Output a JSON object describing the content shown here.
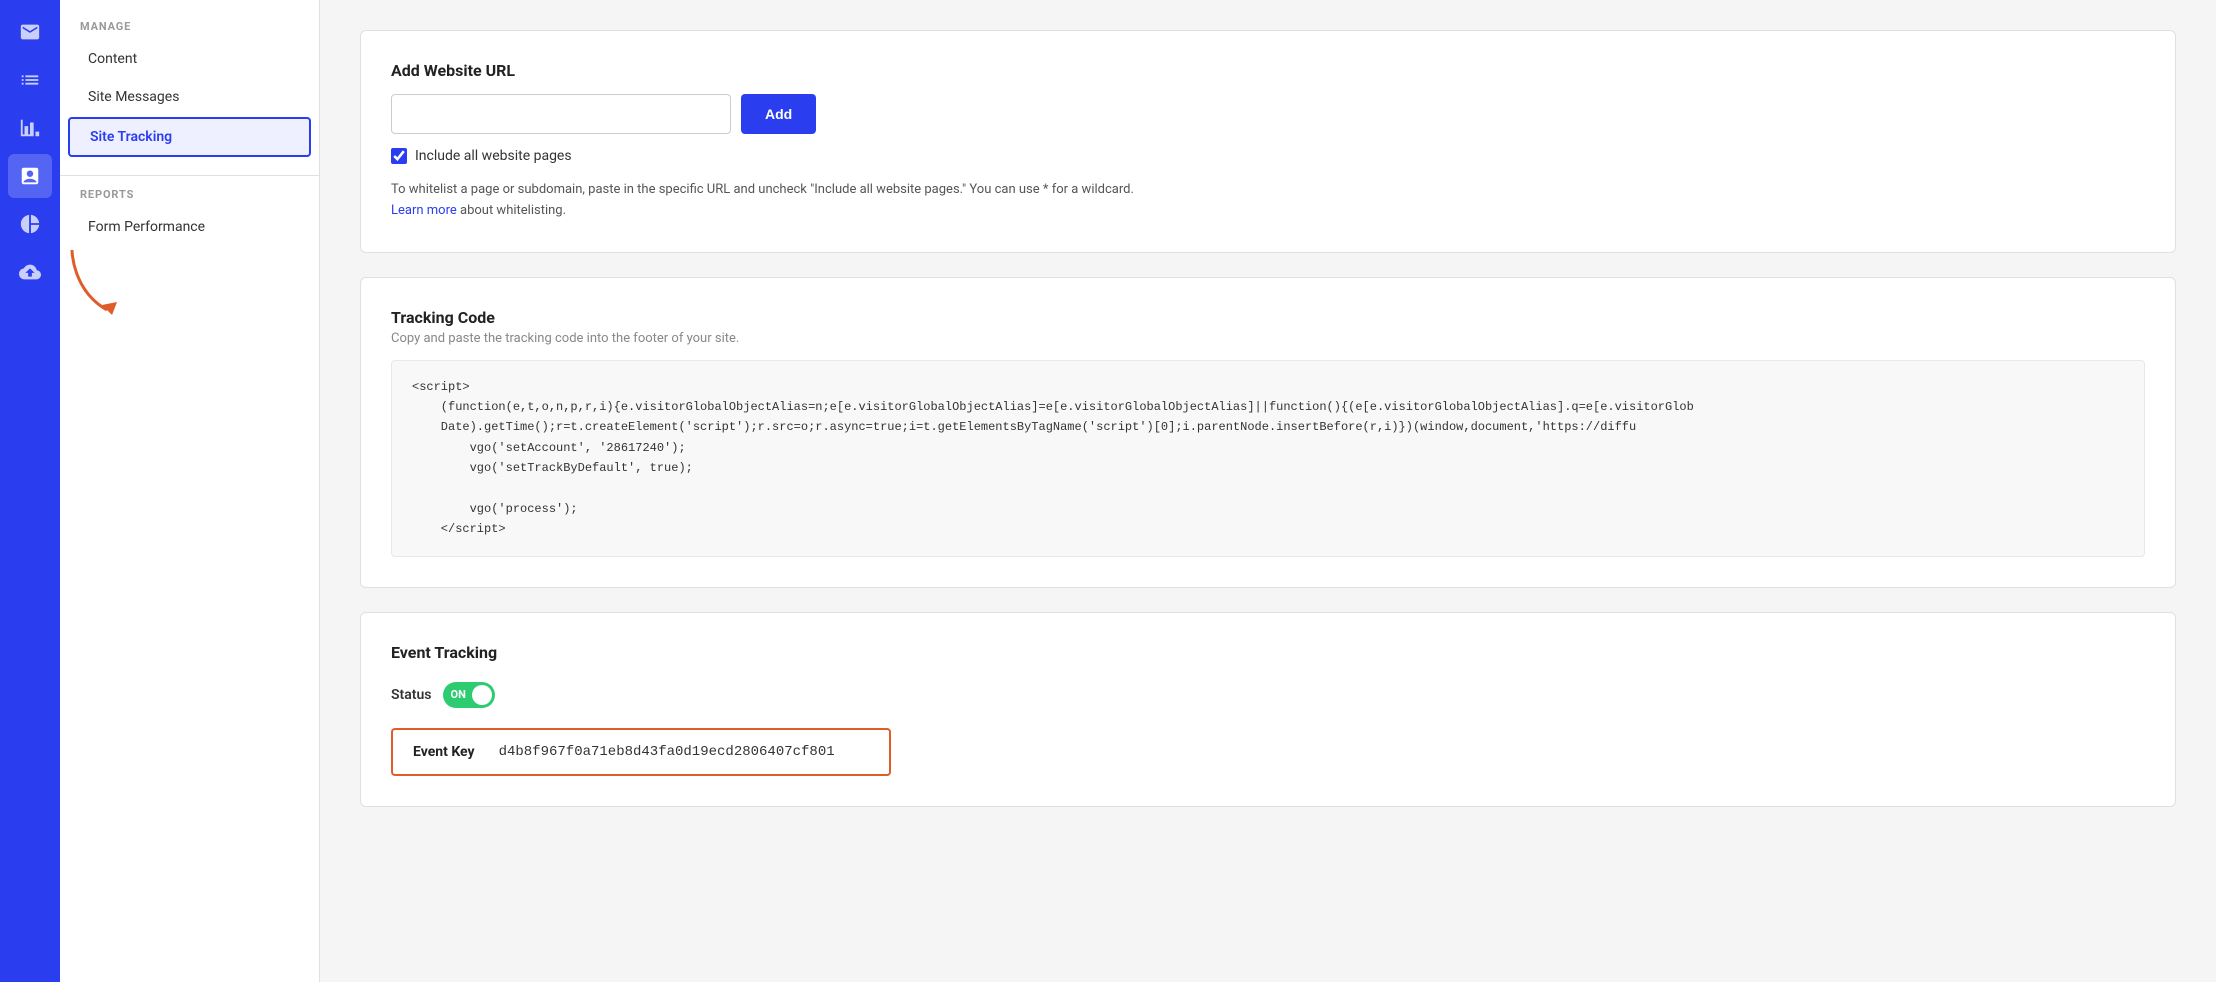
{
  "iconSidebar": {
    "items": [
      {
        "id": "email",
        "icon": "✉",
        "active": false
      },
      {
        "id": "contacts",
        "icon": "☰",
        "active": false
      },
      {
        "id": "analytics",
        "icon": "▮▮",
        "active": false
      },
      {
        "id": "campaigns",
        "icon": "▦",
        "active": true
      },
      {
        "id": "pie",
        "icon": "◔",
        "active": false
      },
      {
        "id": "upload",
        "icon": "⬆",
        "active": false
      }
    ]
  },
  "sidebar": {
    "manageLabel": "MANAGE",
    "items": [
      {
        "id": "content",
        "label": "Content",
        "active": false
      },
      {
        "id": "site-messages",
        "label": "Site Messages",
        "active": false
      },
      {
        "id": "site-tracking",
        "label": "Site Tracking",
        "active": true
      }
    ],
    "reportsLabel": "REPORTS",
    "reportItems": [
      {
        "id": "form-performance",
        "label": "Form Performance",
        "active": false
      }
    ]
  },
  "main": {
    "addWebsiteUrl": {
      "title": "Add Website URL",
      "inputPlaceholder": "",
      "addButtonLabel": "Add",
      "checkboxLabel": "Include all website pages",
      "infoText": "To whitelist a page or subdomain, paste in the specific URL and uncheck \"Include all website pages.\" You can use * for a wildcard.",
      "learnMoreText": "Learn more",
      "whitelistText": " about whitelisting."
    },
    "trackingCode": {
      "title": "Tracking Code",
      "subtitle": "Copy and paste the tracking code into the footer of your site.",
      "code": "<script>\n    (function(e,t,o,n,p,r,i){e.visitorGlobalObjectAlias=n;e[e.visitorGlobalObjectAlias]=e[e.visitorGlobalObjectAlias]||function(){(e[e.visitorGlobalObjectAlias].q=e[e.visitorGlob\n    Date).getTime();r=t.createElement('script');r.src=o;r.async=true;i=t.getElementsByTagName('script')[0];i.parentNode.insertBefore(r,i)})(window,document,'https://diffu\n        vgo('setAccount', '28617240');\n        vgo('setTrackByDefault', true);\n\n        vgo('process');\n    </script>"
    },
    "eventTracking": {
      "title": "Event Tracking",
      "statusLabel": "Status",
      "toggleState": "ON",
      "eventKeyLabel": "Event Key",
      "eventKeyValue": "d4b8f967f0a71eb8d43fa0d19ecd2806407cf801"
    }
  }
}
